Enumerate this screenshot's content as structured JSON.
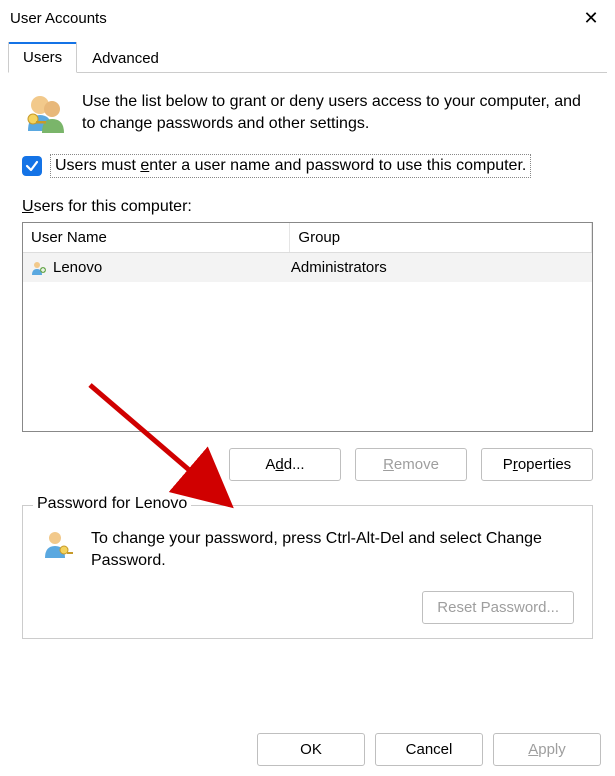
{
  "title": "User Accounts",
  "tabs": {
    "users": "Users",
    "advanced": "Advanced"
  },
  "intro": "Use the list below to grant or deny users access to your computer, and to change passwords and other settings.",
  "checkbox_label_pre": "Users must ",
  "checkbox_label_u": "e",
  "checkbox_label_mid": "nter a user name and password to use this computer.",
  "users_label_u": "U",
  "users_label_rest": "sers for this computer:",
  "columns": {
    "name": "User Name",
    "group": "Group"
  },
  "rows": [
    {
      "name": "Lenovo",
      "group": "Administrators"
    }
  ],
  "buttons": {
    "add_u": "d",
    "add_pre": "A",
    "add_post": "d...",
    "remove_u": "R",
    "remove_post": "emove",
    "props_pre": "P",
    "props_u": "r",
    "props_post": "operties"
  },
  "groupbox_title": "Password for Lenovo",
  "groupbox_text": "To change your password, press Ctrl-Alt-Del and select Change Password.",
  "reset_pre": "Reset ",
  "reset_u": "P",
  "reset_post": "assword...",
  "footer": {
    "ok": "OK",
    "cancel": "Cancel",
    "apply_u": "A",
    "apply_post": "pply"
  }
}
